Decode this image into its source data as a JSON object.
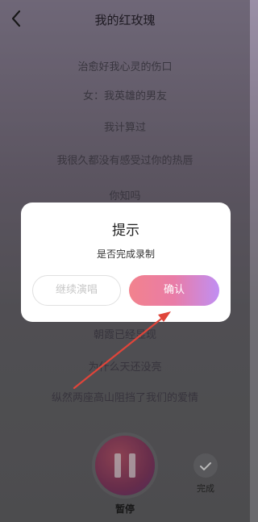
{
  "header": {
    "title": "我的红玫瑰"
  },
  "lyrics": [
    "治愈好我心灵的伤口",
    "女：我英雄的男友",
    "我计算过",
    "我很久都没有感受过你的热唇",
    "你知吗",
    "朝霞已经显现",
    "为什么天还没亮",
    "纵然两座高山阻挡了我们的爱情"
  ],
  "dialog": {
    "title": "提示",
    "message": "是否完成录制",
    "continue_label": "继续演唱",
    "confirm_label": "确认"
  },
  "controls": {
    "pause_label": "暂停",
    "done_label": "完成"
  },
  "icons": {
    "back": "chevron-left-icon",
    "pause": "pause-icon",
    "done": "check-icon"
  },
  "colors": {
    "confirm_gradient_start": "#f2828d",
    "confirm_gradient_end": "#c08ff3",
    "annotation": "#e0453a"
  }
}
